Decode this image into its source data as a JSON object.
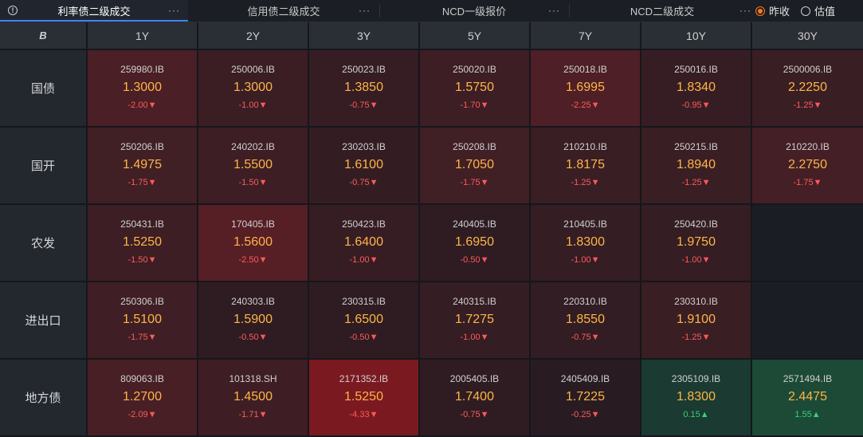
{
  "tabs": [
    {
      "label": "利率债二级成交",
      "more": "···",
      "active": true
    },
    {
      "label": "信用债二级成交",
      "more": "···",
      "active": false
    },
    {
      "label": "NCD一级报价",
      "more": "···",
      "active": false
    },
    {
      "label": "NCD二级成交",
      "more": "···",
      "active": false
    }
  ],
  "radio": [
    {
      "label": "昨收",
      "checked": true
    },
    {
      "label": "估值",
      "checked": false
    }
  ],
  "corner_glyph": "B",
  "columns": [
    "1Y",
    "2Y",
    "3Y",
    "5Y",
    "7Y",
    "10Y",
    "30Y"
  ],
  "rows": [
    {
      "label": "国债",
      "cells": [
        {
          "code": "259980.IB",
          "rate": "1.3000",
          "change": "-2.00▼",
          "bg": "#4a1f25"
        },
        {
          "code": "250006.IB",
          "rate": "1.3000",
          "change": "-1.00▼",
          "bg": "#3a1e24"
        },
        {
          "code": "250023.IB",
          "rate": "1.3850",
          "change": "-0.75▼",
          "bg": "#351d23"
        },
        {
          "code": "250020.IB",
          "rate": "1.5750",
          "change": "-1.70▼",
          "bg": "#3d1e24"
        },
        {
          "code": "250018.IB",
          "rate": "1.6995",
          "change": "-2.25▼",
          "bg": "#4e1f26"
        },
        {
          "code": "250016.IB",
          "rate": "1.8340",
          "change": "-0.95▼",
          "bg": "#361d23"
        },
        {
          "code": "2500006.IB",
          "rate": "2.2250",
          "change": "-1.25▼",
          "bg": "#391e24"
        }
      ]
    },
    {
      "label": "国开",
      "cells": [
        {
          "code": "250206.IB",
          "rate": "1.4975",
          "change": "-1.75▼",
          "bg": "#401f25"
        },
        {
          "code": "240202.IB",
          "rate": "1.5500",
          "change": "-1.50▼",
          "bg": "#3c1e24"
        },
        {
          "code": "230203.IB",
          "rate": "1.6100",
          "change": "-0.75▼",
          "bg": "#331d23"
        },
        {
          "code": "250208.IB",
          "rate": "1.7050",
          "change": "-1.75▼",
          "bg": "#401f25"
        },
        {
          "code": "210210.IB",
          "rate": "1.8175",
          "change": "-1.25▼",
          "bg": "#391e24"
        },
        {
          "code": "250215.IB",
          "rate": "1.8940",
          "change": "-1.25▼",
          "bg": "#391e24"
        },
        {
          "code": "210220.IB",
          "rate": "2.2750",
          "change": "-1.75▼",
          "bg": "#441f25"
        }
      ]
    },
    {
      "label": "农发",
      "cells": [
        {
          "code": "250431.IB",
          "rate": "1.5250",
          "change": "-1.50▼",
          "bg": "#3c1e24"
        },
        {
          "code": "170405.IB",
          "rate": "1.5600",
          "change": "-2.50▼",
          "bg": "#561f26"
        },
        {
          "code": "250423.IB",
          "rate": "1.6400",
          "change": "-1.00▼",
          "bg": "#361d23"
        },
        {
          "code": "240405.IB",
          "rate": "1.6950",
          "change": "-0.50▼",
          "bg": "#2e1c22"
        },
        {
          "code": "210405.IB",
          "rate": "1.8300",
          "change": "-1.00▼",
          "bg": "#341d23"
        },
        {
          "code": "250420.IB",
          "rate": "1.9750",
          "change": "-1.00▼",
          "bg": "#341d23"
        },
        null
      ]
    },
    {
      "label": "进出口",
      "cells": [
        {
          "code": "250306.IB",
          "rate": "1.5100",
          "change": "-1.75▼",
          "bg": "#3f1f25"
        },
        {
          "code": "240303.IB",
          "rate": "1.5900",
          "change": "-0.50▼",
          "bg": "#2e1c22"
        },
        {
          "code": "230315.IB",
          "rate": "1.6500",
          "change": "-0.50▼",
          "bg": "#2e1c22"
        },
        {
          "code": "240315.IB",
          "rate": "1.7275",
          "change": "-1.00▼",
          "bg": "#341d23"
        },
        {
          "code": "220310.IB",
          "rate": "1.8550",
          "change": "-0.75▼",
          "bg": "#311d23"
        },
        {
          "code": "230310.IB",
          "rate": "1.9100",
          "change": "-1.25▼",
          "bg": "#391e24"
        },
        null
      ]
    },
    {
      "label": "地方债",
      "cells": [
        {
          "code": "809063.IB",
          "rate": "1.2700",
          "change": "-2.09▼",
          "bg": "#481f25"
        },
        {
          "code": "101318.SH",
          "rate": "1.4500",
          "change": "-1.71▼",
          "bg": "#3e1e24"
        },
        {
          "code": "2171352.IB",
          "rate": "1.5250",
          "change": "-4.33▼",
          "bg": "#7a1a20"
        },
        {
          "code": "2005405.IB",
          "rate": "1.7400",
          "change": "-0.75▼",
          "bg": "#2f1c22"
        },
        {
          "code": "2405409.IB",
          "rate": "1.7225",
          "change": "-0.25▼",
          "bg": "#281c22"
        },
        {
          "code": "2305109.IB",
          "rate": "1.8300",
          "change": "0.15▲",
          "bg": "#1b3a31",
          "up": true
        },
        {
          "code": "2571494.IB",
          "rate": "2.4475",
          "change": "1.55▲",
          "bg": "#1c4a36",
          "up": true
        }
      ]
    }
  ]
}
